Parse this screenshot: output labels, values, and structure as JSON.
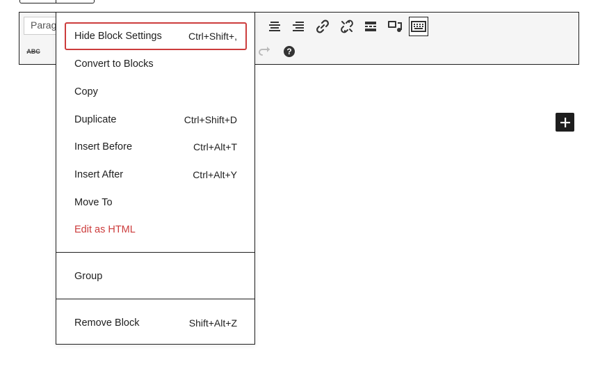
{
  "toolbar": {
    "format_select_value": "Paragraph"
  },
  "context_menu": {
    "items": [
      {
        "label": "Hide Block Settings",
        "shortcut": "Ctrl+Shift+,"
      },
      {
        "label": "Convert to Blocks",
        "shortcut": ""
      },
      {
        "label": "Copy",
        "shortcut": ""
      },
      {
        "label": "Duplicate",
        "shortcut": "Ctrl+Shift+D"
      },
      {
        "label": "Insert Before",
        "shortcut": "Ctrl+Alt+T"
      },
      {
        "label": "Insert After",
        "shortcut": "Ctrl+Alt+Y"
      },
      {
        "label": "Move To",
        "shortcut": ""
      },
      {
        "label": "Edit as HTML",
        "shortcut": ""
      }
    ],
    "group": {
      "label": "Group"
    },
    "remove": {
      "label": "Remove Block",
      "shortcut": "Shift+Alt+Z"
    }
  },
  "icons": {
    "strikethrough": "ABC",
    "help": "?"
  },
  "colors": {
    "focus_ring": "#cc3c3c",
    "danger_text": "#cc3c3c",
    "dark": "#1e1e1e"
  }
}
